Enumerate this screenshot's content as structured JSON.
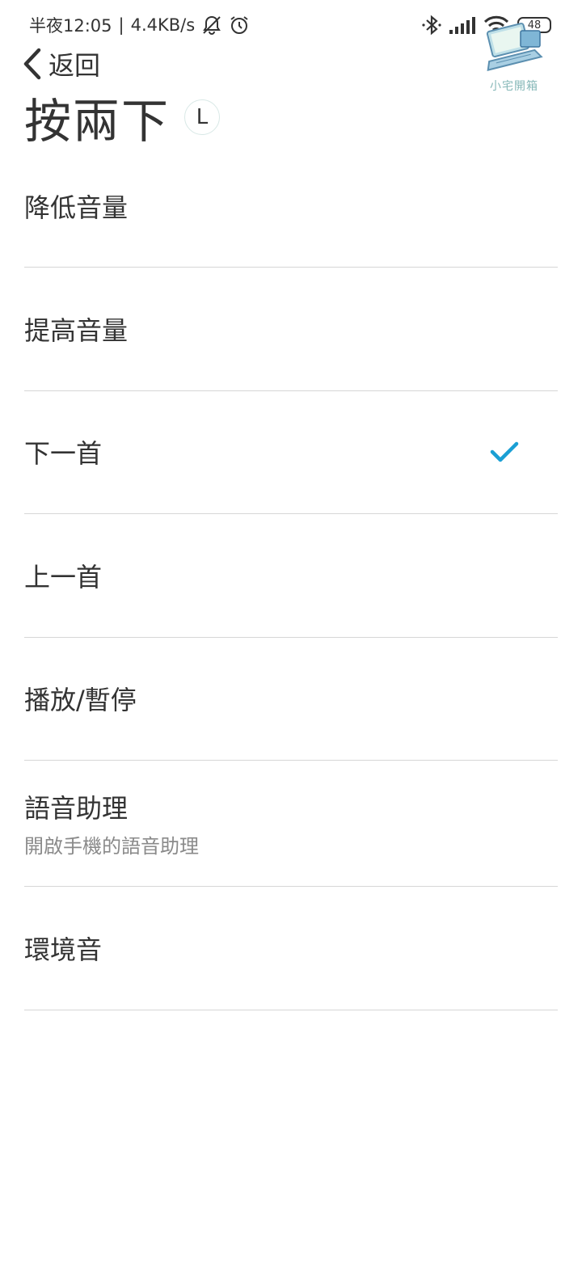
{
  "status_bar": {
    "time": "半夜12:05",
    "separator": "|",
    "net_speed": "4.4KB/s",
    "battery": "48"
  },
  "watermark": {
    "text": "小宅開箱"
  },
  "header": {
    "back_label": "返回",
    "title": "按兩下",
    "side_badge": "L"
  },
  "options": [
    {
      "label": "降低音量",
      "selected": false
    },
    {
      "label": "提高音量",
      "selected": false
    },
    {
      "label": "下一首",
      "selected": true
    },
    {
      "label": "上一首",
      "selected": false
    },
    {
      "label": "播放/暫停",
      "selected": false
    },
    {
      "label": "語音助理",
      "sublabel": "開啟手機的語音助理",
      "selected": false
    },
    {
      "label": "環境音",
      "selected": false
    }
  ],
  "colors": {
    "accent": "#1a9fd4",
    "divider": "#d6d6d6",
    "text": "#333333",
    "subtext": "#8a8a8a"
  }
}
